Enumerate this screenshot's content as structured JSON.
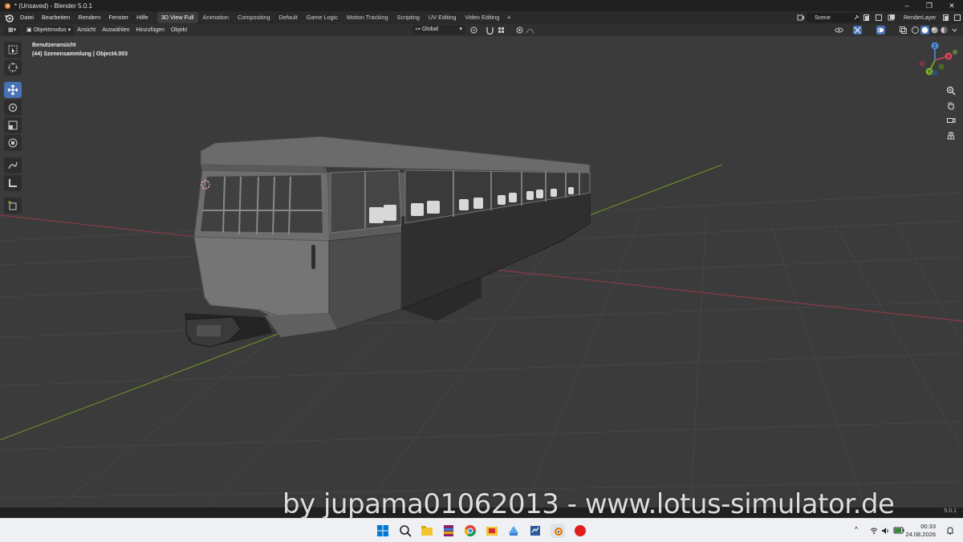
{
  "window": {
    "title": "* (Unsaved) - Blender 5.0.1",
    "controls": [
      "–",
      "❐",
      "✕"
    ]
  },
  "menu": [
    "Datei",
    "Bearbeiten",
    "Rendern",
    "Fenster",
    "Hilfe"
  ],
  "workspaces": [
    {
      "label": "3D View Full",
      "active": true
    },
    {
      "label": "Animation",
      "active": false
    },
    {
      "label": "Compositing",
      "active": false
    },
    {
      "label": "Default",
      "active": false
    },
    {
      "label": "Game Logic",
      "active": false
    },
    {
      "label": "Motion Tracking",
      "active": false
    },
    {
      "label": "Scripting",
      "active": false
    },
    {
      "label": "UV Editing",
      "active": false
    },
    {
      "label": "Video Editing",
      "active": false
    }
  ],
  "workspace_add": "+",
  "scene": {
    "label": "Scene"
  },
  "render_layer": {
    "label": "RenderLayer"
  },
  "viewport_header": {
    "mode": "Objektmodus",
    "menus": [
      "Ansicht",
      "Auswählen",
      "Hinzufügen",
      "Objekt"
    ],
    "transform_orientation": "Global"
  },
  "viewport": {
    "view_name": "Benutzeransicht",
    "collection_info": "(44) Szenensammlung | Object4.003"
  },
  "gizmo": {
    "x": "X",
    "y": "Y",
    "z": "Z"
  },
  "status": {
    "version": "5.0.1"
  },
  "watermark": "by jupama01062013 - www.lotus-simulator.de",
  "taskbar": {
    "time": "00:33",
    "date": "24.08.2026"
  },
  "colors": {
    "accent": "#4772b3",
    "viewport_bg": "#3b3b3b",
    "x_axis": "#8b3a45",
    "y_axis": "#6a8a2a"
  }
}
